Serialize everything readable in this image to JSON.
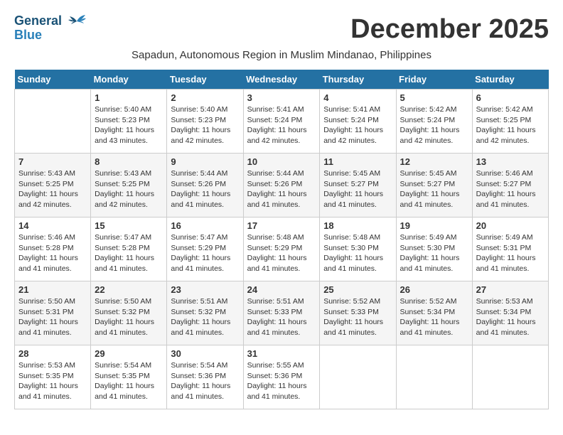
{
  "header": {
    "logo_line1": "General",
    "logo_line2": "Blue",
    "month_title": "December 2025",
    "subtitle": "Sapadun, Autonomous Region in Muslim Mindanao, Philippines"
  },
  "weekdays": [
    "Sunday",
    "Monday",
    "Tuesday",
    "Wednesday",
    "Thursday",
    "Friday",
    "Saturday"
  ],
  "weeks": [
    [
      {
        "day": "",
        "info": ""
      },
      {
        "day": "1",
        "info": "Sunrise: 5:40 AM\nSunset: 5:23 PM\nDaylight: 11 hours\nand 43 minutes."
      },
      {
        "day": "2",
        "info": "Sunrise: 5:40 AM\nSunset: 5:23 PM\nDaylight: 11 hours\nand 42 minutes."
      },
      {
        "day": "3",
        "info": "Sunrise: 5:41 AM\nSunset: 5:24 PM\nDaylight: 11 hours\nand 42 minutes."
      },
      {
        "day": "4",
        "info": "Sunrise: 5:41 AM\nSunset: 5:24 PM\nDaylight: 11 hours\nand 42 minutes."
      },
      {
        "day": "5",
        "info": "Sunrise: 5:42 AM\nSunset: 5:24 PM\nDaylight: 11 hours\nand 42 minutes."
      },
      {
        "day": "6",
        "info": "Sunrise: 5:42 AM\nSunset: 5:25 PM\nDaylight: 11 hours\nand 42 minutes."
      }
    ],
    [
      {
        "day": "7",
        "info": "Sunrise: 5:43 AM\nSunset: 5:25 PM\nDaylight: 11 hours\nand 42 minutes."
      },
      {
        "day": "8",
        "info": "Sunrise: 5:43 AM\nSunset: 5:25 PM\nDaylight: 11 hours\nand 42 minutes."
      },
      {
        "day": "9",
        "info": "Sunrise: 5:44 AM\nSunset: 5:26 PM\nDaylight: 11 hours\nand 41 minutes."
      },
      {
        "day": "10",
        "info": "Sunrise: 5:44 AM\nSunset: 5:26 PM\nDaylight: 11 hours\nand 41 minutes."
      },
      {
        "day": "11",
        "info": "Sunrise: 5:45 AM\nSunset: 5:27 PM\nDaylight: 11 hours\nand 41 minutes."
      },
      {
        "day": "12",
        "info": "Sunrise: 5:45 AM\nSunset: 5:27 PM\nDaylight: 11 hours\nand 41 minutes."
      },
      {
        "day": "13",
        "info": "Sunrise: 5:46 AM\nSunset: 5:27 PM\nDaylight: 11 hours\nand 41 minutes."
      }
    ],
    [
      {
        "day": "14",
        "info": "Sunrise: 5:46 AM\nSunset: 5:28 PM\nDaylight: 11 hours\nand 41 minutes."
      },
      {
        "day": "15",
        "info": "Sunrise: 5:47 AM\nSunset: 5:28 PM\nDaylight: 11 hours\nand 41 minutes."
      },
      {
        "day": "16",
        "info": "Sunrise: 5:47 AM\nSunset: 5:29 PM\nDaylight: 11 hours\nand 41 minutes."
      },
      {
        "day": "17",
        "info": "Sunrise: 5:48 AM\nSunset: 5:29 PM\nDaylight: 11 hours\nand 41 minutes."
      },
      {
        "day": "18",
        "info": "Sunrise: 5:48 AM\nSunset: 5:30 PM\nDaylight: 11 hours\nand 41 minutes."
      },
      {
        "day": "19",
        "info": "Sunrise: 5:49 AM\nSunset: 5:30 PM\nDaylight: 11 hours\nand 41 minutes."
      },
      {
        "day": "20",
        "info": "Sunrise: 5:49 AM\nSunset: 5:31 PM\nDaylight: 11 hours\nand 41 minutes."
      }
    ],
    [
      {
        "day": "21",
        "info": "Sunrise: 5:50 AM\nSunset: 5:31 PM\nDaylight: 11 hours\nand 41 minutes."
      },
      {
        "day": "22",
        "info": "Sunrise: 5:50 AM\nSunset: 5:32 PM\nDaylight: 11 hours\nand 41 minutes."
      },
      {
        "day": "23",
        "info": "Sunrise: 5:51 AM\nSunset: 5:32 PM\nDaylight: 11 hours\nand 41 minutes."
      },
      {
        "day": "24",
        "info": "Sunrise: 5:51 AM\nSunset: 5:33 PM\nDaylight: 11 hours\nand 41 minutes."
      },
      {
        "day": "25",
        "info": "Sunrise: 5:52 AM\nSunset: 5:33 PM\nDaylight: 11 hours\nand 41 minutes."
      },
      {
        "day": "26",
        "info": "Sunrise: 5:52 AM\nSunset: 5:34 PM\nDaylight: 11 hours\nand 41 minutes."
      },
      {
        "day": "27",
        "info": "Sunrise: 5:53 AM\nSunset: 5:34 PM\nDaylight: 11 hours\nand 41 minutes."
      }
    ],
    [
      {
        "day": "28",
        "info": "Sunrise: 5:53 AM\nSunset: 5:35 PM\nDaylight: 11 hours\nand 41 minutes."
      },
      {
        "day": "29",
        "info": "Sunrise: 5:54 AM\nSunset: 5:35 PM\nDaylight: 11 hours\nand 41 minutes."
      },
      {
        "day": "30",
        "info": "Sunrise: 5:54 AM\nSunset: 5:36 PM\nDaylight: 11 hours\nand 41 minutes."
      },
      {
        "day": "31",
        "info": "Sunrise: 5:55 AM\nSunset: 5:36 PM\nDaylight: 11 hours\nand 41 minutes."
      },
      {
        "day": "",
        "info": ""
      },
      {
        "day": "",
        "info": ""
      },
      {
        "day": "",
        "info": ""
      }
    ]
  ]
}
